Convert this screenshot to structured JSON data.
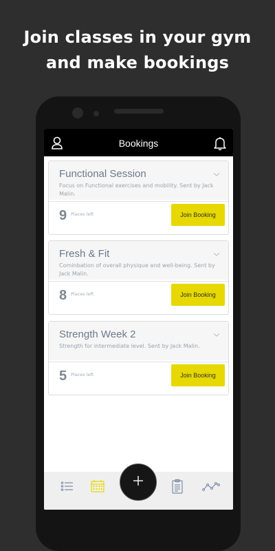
{
  "promo": {
    "line1": "Join classes in your gym",
    "line2": "and make bookings"
  },
  "appbar": {
    "title": "Bookings",
    "left_icon": "user-icon",
    "right_icon": "bell-icon"
  },
  "bookings": [
    {
      "title": "Functional Session",
      "description": "Focus on Functional exercises and mobility. Sent by Jack Malin.",
      "places": "9",
      "places_label": "Places left",
      "button": "Join Booking"
    },
    {
      "title": "Fresh & Fit",
      "description": "Cominbation of overall physique and well-being. Sent by Jack Malin.",
      "places": "8",
      "places_label": "Places left",
      "button": "Join Booking"
    },
    {
      "title": "Strength Week 2",
      "description": "Strength for intermediate level. Sent by Jack Malin.",
      "places": "5",
      "places_label": "Places left",
      "button": "Join Booking"
    }
  ],
  "bottom_nav": {
    "items": [
      "list-icon",
      "calendar-icon",
      "add-icon",
      "clipboard-icon",
      "chart-icon"
    ],
    "active": "calendar-icon"
  },
  "colors": {
    "background": "#2e2e2e",
    "accent": "#e6d800",
    "appbar": "#000000"
  }
}
